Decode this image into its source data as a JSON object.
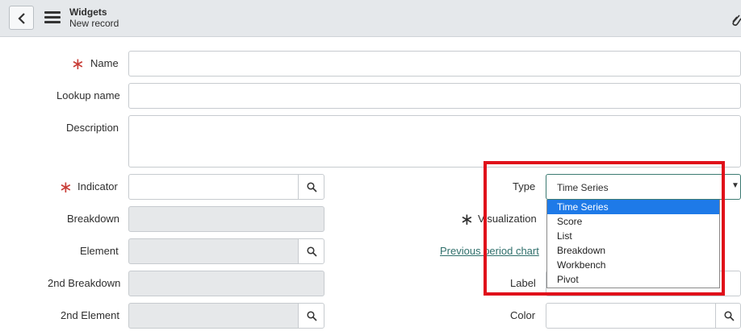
{
  "header": {
    "title": "Widgets",
    "subtitle": "New record"
  },
  "form": {
    "name_label": "Name",
    "lookup_name_label": "Lookup name",
    "description_label": "Description",
    "indicator_label": "Indicator",
    "breakdown_label": "Breakdown",
    "element_label": "Element",
    "second_breakdown_label": "2nd Breakdown",
    "second_element_label": "2nd Element",
    "type_label": "Type",
    "visualization_label": "Visualization",
    "previous_period_link": "Previous period chart",
    "label_label": "Label",
    "color_label": "Color"
  },
  "type_select": {
    "selected": "Time Series",
    "options": [
      "Time Series",
      "Score",
      "List",
      "Breakdown",
      "Workbench",
      "Pivot"
    ]
  },
  "colors": {
    "required": "#c83c36",
    "highlight": "#e0101a",
    "selected_option": "#1e7ae8",
    "link": "#2f6f6b",
    "header_bg": "#e5e8eb"
  },
  "icons": [
    "back-arrow-icon",
    "menu-icon",
    "paperclip-icon",
    "search-icon",
    "chevron-down-icon",
    "asterisk-icon"
  ]
}
